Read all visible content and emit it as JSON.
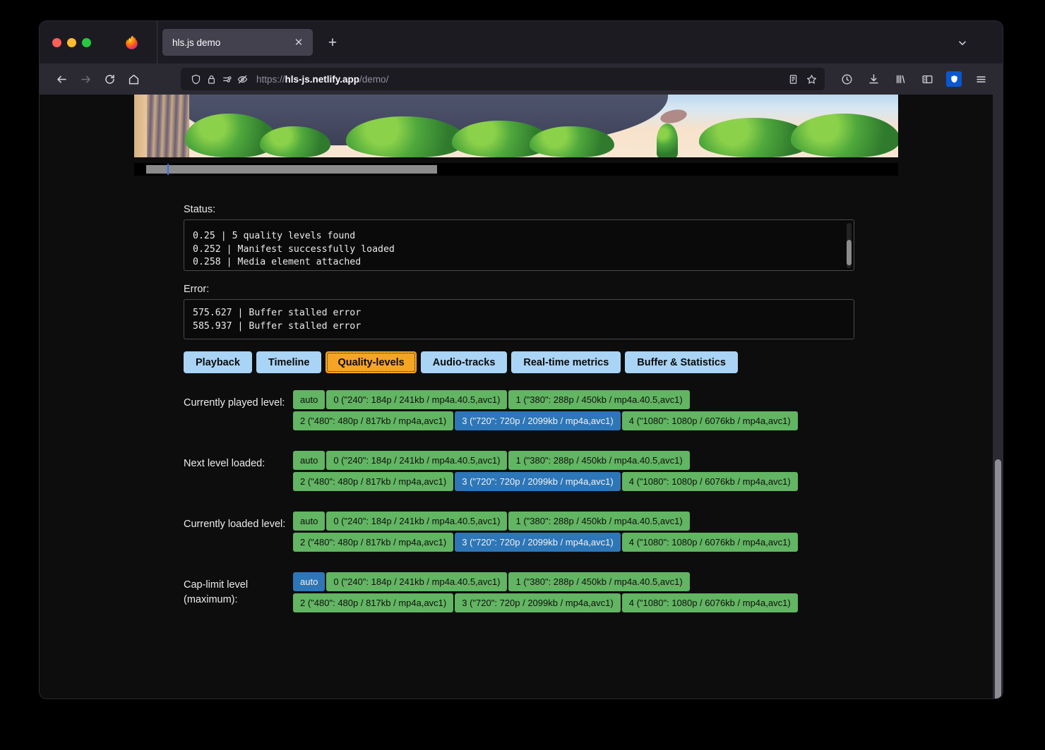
{
  "browser": {
    "window_controls": [
      "close",
      "minimize",
      "maximize"
    ],
    "tab": {
      "title": "hls.js demo",
      "close_label": "✕"
    },
    "new_tab_label": "+",
    "nav": {
      "back": "back-arrow",
      "forward": "forward-arrow",
      "reload": "reload",
      "home": "home"
    },
    "urlbar": {
      "protocol": "https://",
      "host": "hls-js.netlify.app",
      "path": "/demo/",
      "full_url": "https://hls-js.netlify.app/demo/",
      "icons": [
        "shield-icon",
        "lock-icon",
        "permissions-icon",
        "no-tracking-icon"
      ],
      "right_icons": [
        "reader-mode-icon",
        "bookmark-star-icon"
      ]
    },
    "toolbar_icons": [
      "history-icon",
      "downloads-icon",
      "library-icon",
      "sidebar-icon",
      "shield-extension-icon",
      "application-menu-icon"
    ],
    "accent": "#0a57d0"
  },
  "player": {
    "seek": {
      "buffered_percent": 38,
      "playhead_percent": 4.3
    }
  },
  "status": {
    "label": "Status:",
    "lines": [
      "0.25 | 5 quality levels found",
      "0.252 | Manifest successfully loaded",
      "0.258 | Media element attached"
    ]
  },
  "error": {
    "label": "Error:",
    "lines": [
      "575.627 | Buffer stalled error",
      "585.937 | Buffer stalled error"
    ]
  },
  "tabs": [
    {
      "label": "Playback",
      "active": false
    },
    {
      "label": "Timeline",
      "active": false
    },
    {
      "label": "Quality-levels",
      "active": true
    },
    {
      "label": "Audio-tracks",
      "active": false
    },
    {
      "label": "Real-time metrics",
      "active": false
    },
    {
      "label": "Buffer & Statistics",
      "active": false
    }
  ],
  "levels": [
    "auto",
    "0 (\"240\": 184p / 241kb / mp4a.40.5,avc1)",
    "1 (\"380\": 288p / 450kb / mp4a.40.5,avc1)",
    "2 (\"480\": 480p / 817kb / mp4a,avc1)",
    "3 (\"720\": 720p / 2099kb / mp4a,avc1)",
    "4 (\"1080\": 1080p / 6076kb / mp4a,avc1)"
  ],
  "level_rows": [
    {
      "label": "Currently played level:",
      "selected_index": 4,
      "options": [
        "auto",
        "0 (\"240\": 184p / 241kb / mp4a.40.5,avc1)",
        "1 (\"380\": 288p / 450kb / mp4a.40.5,avc1)",
        "2 (\"480\": 480p / 817kb / mp4a,avc1)",
        "3 (\"720\": 720p / 2099kb / mp4a,avc1)",
        "4 (\"1080\": 1080p / 6076kb / mp4a,avc1)"
      ]
    },
    {
      "label": "Next level loaded:",
      "selected_index": 4,
      "options": [
        "auto",
        "0 (\"240\": 184p / 241kb / mp4a.40.5,avc1)",
        "1 (\"380\": 288p / 450kb / mp4a.40.5,avc1)",
        "2 (\"480\": 480p / 817kb / mp4a,avc1)",
        "3 (\"720\": 720p / 2099kb / mp4a,avc1)",
        "4 (\"1080\": 1080p / 6076kb / mp4a,avc1)"
      ]
    },
    {
      "label": "Currently loaded level:",
      "selected_index": 4,
      "options": [
        "auto",
        "0 (\"240\": 184p / 241kb / mp4a.40.5,avc1)",
        "1 (\"380\": 288p / 450kb / mp4a.40.5,avc1)",
        "2 (\"480\": 480p / 817kb / mp4a,avc1)",
        "3 (\"720\": 720p / 2099kb / mp4a,avc1)",
        "4 (\"1080\": 1080p / 6076kb / mp4a,avc1)"
      ]
    },
    {
      "label": "Cap-limit level (maximum):",
      "selected_index": 0,
      "options": [
        "auto",
        "0 (\"240\": 184p / 241kb / mp4a.40.5,avc1)",
        "1 (\"380\": 288p / 450kb / mp4a.40.5,avc1)",
        "2 (\"480\": 480p / 817kb / mp4a,avc1)",
        "3 (\"720\": 720p / 2099kb / mp4a,avc1)",
        "4 (\"1080\": 1080p / 6076kb / mp4a,avc1)"
      ]
    }
  ],
  "colors": {
    "level_default": "#62b562",
    "level_selected": "#2d76b8",
    "tab_default": "#a9d4f5",
    "tab_active": "#f5a524"
  }
}
